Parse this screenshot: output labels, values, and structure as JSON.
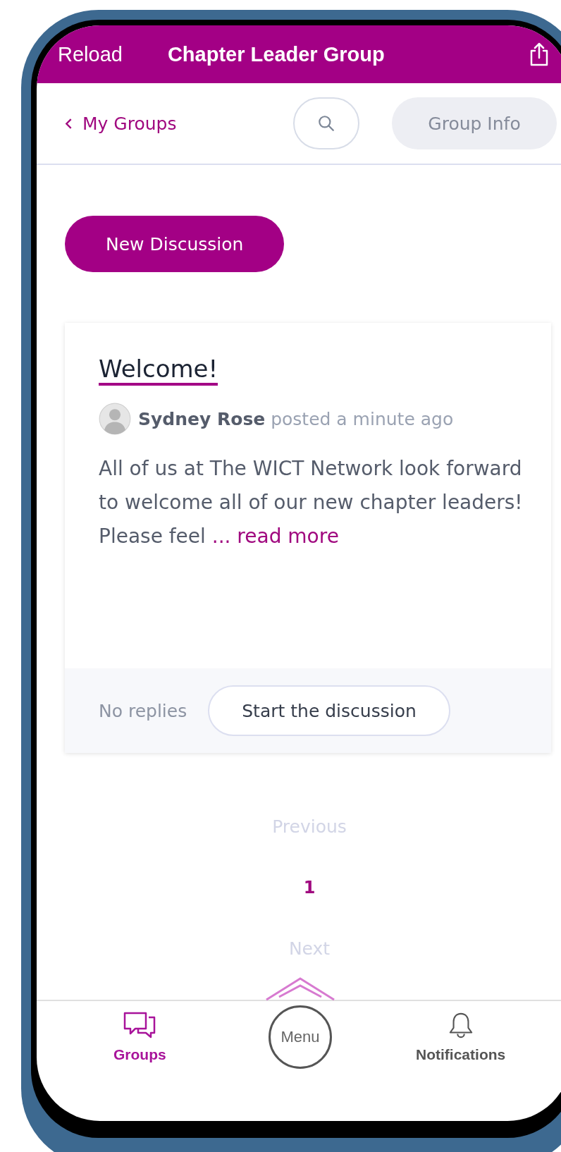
{
  "top_bar": {
    "left_action": "Reload",
    "title": "Chapter Leader Group"
  },
  "header": {
    "back_link": "My Groups",
    "info_button": "Group Info"
  },
  "new_discussion_button": "New Discussion",
  "discussion": {
    "title": "Welcome!",
    "author": "Sydney Rose",
    "posted": "posted a minute ago",
    "body": "All of us at The WICT Network look forward to welcome all of our new chapter leaders! Please feel ",
    "read_more": "... read more",
    "replies": "No replies",
    "start_button": "Start the discussion"
  },
  "pagination": {
    "previous": {
      "label": "Previous",
      "disabled": true
    },
    "pages": [
      {
        "label": "1",
        "selected": true
      }
    ],
    "next": {
      "label": "Next",
      "disabled": true
    }
  },
  "bottom_nav": [
    {
      "kind": "groups",
      "label": "Groups",
      "selected": true
    },
    {
      "kind": "menu",
      "label": "Menu",
      "selected": false
    },
    {
      "kind": "bell",
      "label": "Notifications",
      "selected": false
    }
  ]
}
